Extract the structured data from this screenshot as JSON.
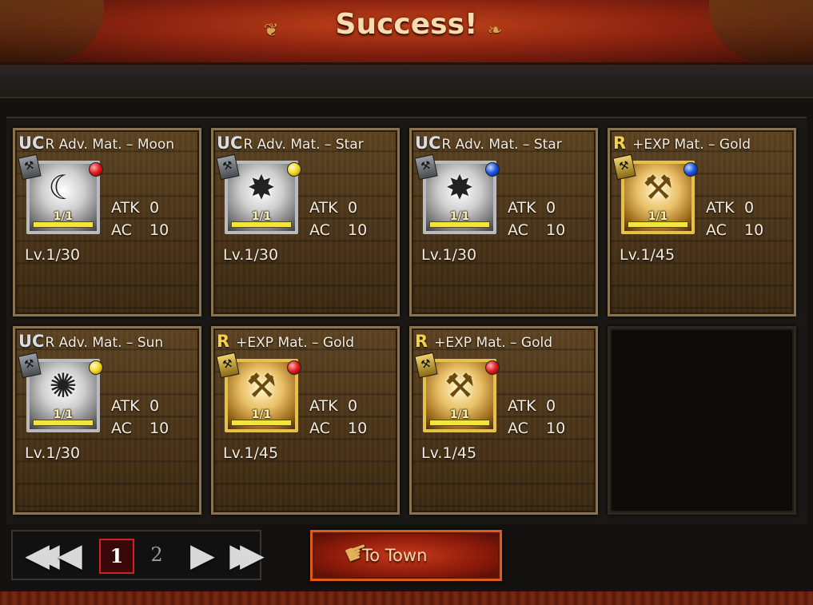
{
  "header": {
    "title": "Success!"
  },
  "cards": [
    {
      "rarity": "UC",
      "name": "R Adv. Mat. – Moon",
      "count": "1/1",
      "atk_label": "ATK",
      "atk": "0",
      "ac_label": "AC",
      "ac": "10",
      "level": "Lv.1/30",
      "frame": "silver",
      "orb": "red",
      "glyph": "☾",
      "type_icon": "hammer"
    },
    {
      "rarity": "UC",
      "name": "R Adv. Mat. – Star",
      "count": "1/1",
      "atk_label": "ATK",
      "atk": "0",
      "ac_label": "AC",
      "ac": "10",
      "level": "Lv.1/30",
      "frame": "silver",
      "orb": "yellow",
      "glyph": "✸",
      "type_icon": "hammer"
    },
    {
      "rarity": "UC",
      "name": "R Adv. Mat. – Star",
      "count": "1/1",
      "atk_label": "ATK",
      "atk": "0",
      "ac_label": "AC",
      "ac": "10",
      "level": "Lv.1/30",
      "frame": "silver",
      "orb": "blue",
      "glyph": "✸",
      "type_icon": "hammer"
    },
    {
      "rarity": "R",
      "name": "+EXP Mat. – Gold",
      "count": "1/1",
      "atk_label": "ATK",
      "atk": "0",
      "ac_label": "AC",
      "ac": "10",
      "level": "Lv.1/45",
      "frame": "gold",
      "orb": "blue",
      "glyph": "⚒",
      "type_icon": "hammer"
    },
    {
      "rarity": "UC",
      "name": "R Adv. Mat. – Sun",
      "count": "1/1",
      "atk_label": "ATK",
      "atk": "0",
      "ac_label": "AC",
      "ac": "10",
      "level": "Lv.1/30",
      "frame": "silver",
      "orb": "yellow",
      "glyph": "✺",
      "type_icon": "hammer"
    },
    {
      "rarity": "R",
      "name": "+EXP Mat. – Gold",
      "count": "1/1",
      "atk_label": "ATK",
      "atk": "0",
      "ac_label": "AC",
      "ac": "10",
      "level": "Lv.1/45",
      "frame": "gold",
      "orb": "red",
      "glyph": "⚒",
      "type_icon": "hammer"
    },
    {
      "rarity": "R",
      "name": "+EXP Mat. – Gold",
      "count": "1/1",
      "atk_label": "ATK",
      "atk": "0",
      "ac_label": "AC",
      "ac": "10",
      "level": "Lv.1/45",
      "frame": "gold",
      "orb": "red",
      "glyph": "⚒",
      "type_icon": "hammer"
    }
  ],
  "pager": {
    "pages": [
      "1",
      "2"
    ],
    "current_page": "1",
    "icons": {
      "first": "double-left-arrow-icon",
      "prev": "left-arrow-icon",
      "next": "right-arrow-icon",
      "last": "double-right-arrow-icon"
    }
  },
  "actions": {
    "to_town_label": "To Town",
    "to_town_icon": "pointing-hand-icon"
  },
  "colors": {
    "header_red": "#8e2410",
    "uc_text": "#d8dde4",
    "r_text": "#f2d24a",
    "button_border": "#e25a18",
    "active_page_border": "#d02020"
  }
}
